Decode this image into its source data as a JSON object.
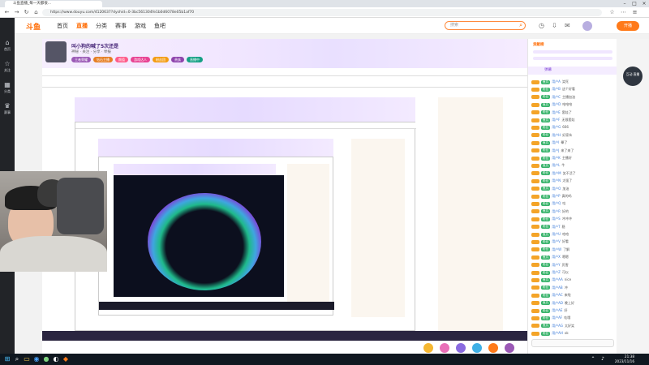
{
  "browser": {
    "tab_title": "斗鱼直播_每一天都很...",
    "url": "https://www.douyu.com/4120637?dyshid=0-3bc561304fe1b0d6078e05b1af70"
  },
  "sidebar": {
    "items": [
      {
        "icon": "home-icon",
        "label": "首页"
      },
      {
        "icon": "star-icon",
        "label": "关注"
      },
      {
        "icon": "grid-icon",
        "label": "分类"
      },
      {
        "icon": "trophy-icon",
        "label": "赛事"
      }
    ]
  },
  "site_nav": {
    "logo": "斗鱼",
    "items": [
      "首页",
      "直播",
      "分类",
      "赛事",
      "游戏",
      "鱼吧"
    ],
    "active_index": 1,
    "search_placeholder": "搜索",
    "live_button": "开播"
  },
  "room": {
    "title": "叫小狗的喊了5次还是",
    "host": "神秘",
    "meta": "关注 · 分享 · 举报",
    "tags": [
      {
        "label": "王者荣耀",
        "color": "#9b59b6"
      },
      {
        "label": "钻石主播",
        "color": "#e67e22"
      },
      {
        "label": "颜值",
        "color": "#ff5c8a"
      },
      {
        "label": "游戏达人",
        "color": "#e84393"
      },
      {
        "label": "粉丝团",
        "color": "#f39c12"
      },
      {
        "label": "贵族",
        "color": "#8e44ad"
      },
      {
        "label": "直播中",
        "color": "#16a085"
      }
    ]
  },
  "chat_panel": {
    "rank_title": "贡献榜",
    "tab_label": "弹幕",
    "messages": [
      {
        "user": "用户A",
        "fan": "鱼丸",
        "text": "笑死"
      },
      {
        "user": "用户B",
        "fan": "粉丝",
        "text": "这个好看"
      },
      {
        "user": "用户C",
        "fan": "粉丝",
        "text": "主播加油"
      },
      {
        "user": "用户D",
        "fan": "鱼丸",
        "text": "哈哈哈"
      },
      {
        "user": "用户E",
        "fan": "粉丝",
        "text": "套娃了"
      },
      {
        "user": "用户F",
        "fan": "鱼丸",
        "text": "无限套娃"
      },
      {
        "user": "用户G",
        "fan": "粉丝",
        "text": "666"
      },
      {
        "user": "用户H",
        "fan": "粉丝",
        "text": "好家伙"
      },
      {
        "user": "用户I",
        "fan": "鱼丸",
        "text": "晕了"
      },
      {
        "user": "用户J",
        "fan": "粉丝",
        "text": "来了来了"
      },
      {
        "user": "用户K",
        "fan": "粉丝",
        "text": "主播好"
      },
      {
        "user": "用户L",
        "fan": "鱼丸",
        "text": "牛"
      },
      {
        "user": "用户M",
        "fan": "粉丝",
        "text": "笑不活了"
      },
      {
        "user": "用户N",
        "fan": "粉丝",
        "text": "太强了"
      },
      {
        "user": "用户O",
        "fan": "鱼丸",
        "text": "加油"
      },
      {
        "user": "用户P",
        "fan": "粉丝",
        "text": "真的吗"
      },
      {
        "user": "用户Q",
        "fan": "粉丝",
        "text": "哇"
      },
      {
        "user": "用户R",
        "fan": "鱼丸",
        "text": "好的"
      },
      {
        "user": "用户S",
        "fan": "粉丝",
        "text": "冲冲冲"
      },
      {
        "user": "用户T",
        "fan": "粉丝",
        "text": "稳"
      },
      {
        "user": "用户U",
        "fan": "鱼丸",
        "text": "哈哈"
      },
      {
        "user": "用户V",
        "fan": "粉丝",
        "text": "好看"
      },
      {
        "user": "用户W",
        "fan": "粉丝",
        "text": "了解"
      },
      {
        "user": "用户X",
        "fan": "鱼丸",
        "text": "嗯嗯"
      },
      {
        "user": "用户Y",
        "fan": "粉丝",
        "text": "厉害"
      },
      {
        "user": "用户Z",
        "fan": "粉丝",
        "text": "可以"
      },
      {
        "user": "用户AA",
        "fan": "鱼丸",
        "text": "nice"
      },
      {
        "user": "用户AB",
        "fan": "粉丝",
        "text": "冲"
      },
      {
        "user": "用户AC",
        "fan": "粉丝",
        "text": "来啦"
      },
      {
        "user": "用户AD",
        "fan": "鱼丸",
        "text": "晚上好"
      },
      {
        "user": "用户AE",
        "fan": "粉丝",
        "text": "好"
      },
      {
        "user": "用户AF",
        "fan": "粉丝",
        "text": "哇哦"
      },
      {
        "user": "用户AG",
        "fan": "鱼丸",
        "text": "太好笑"
      },
      {
        "user": "用户AH",
        "fan": "粉丝",
        "text": "ok"
      }
    ]
  },
  "float_button": "互动\n直播",
  "taskbar": {
    "time": "21:38",
    "date": "2023/11/16"
  }
}
